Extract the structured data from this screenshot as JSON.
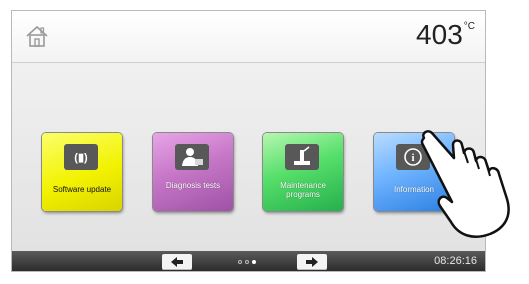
{
  "header": {
    "temperature_value": "403",
    "temperature_unit": "°C"
  },
  "tiles": [
    {
      "label": "Software update",
      "icon": "software-update-icon",
      "color": "#f2f200"
    },
    {
      "label": "Diagnosis tests",
      "icon": "diagnosis-icon",
      "color": "#c777c7"
    },
    {
      "label": "Maintenance programs",
      "icon": "maintenance-icon",
      "color": "#56df6a"
    },
    {
      "label": "Information",
      "icon": "info-icon",
      "color": "#6fb4ff"
    }
  ],
  "footer": {
    "clock": "08:26:16",
    "page_count": 3,
    "active_page": 3
  },
  "overlay": {
    "icon": "pointing-hand-icon"
  }
}
